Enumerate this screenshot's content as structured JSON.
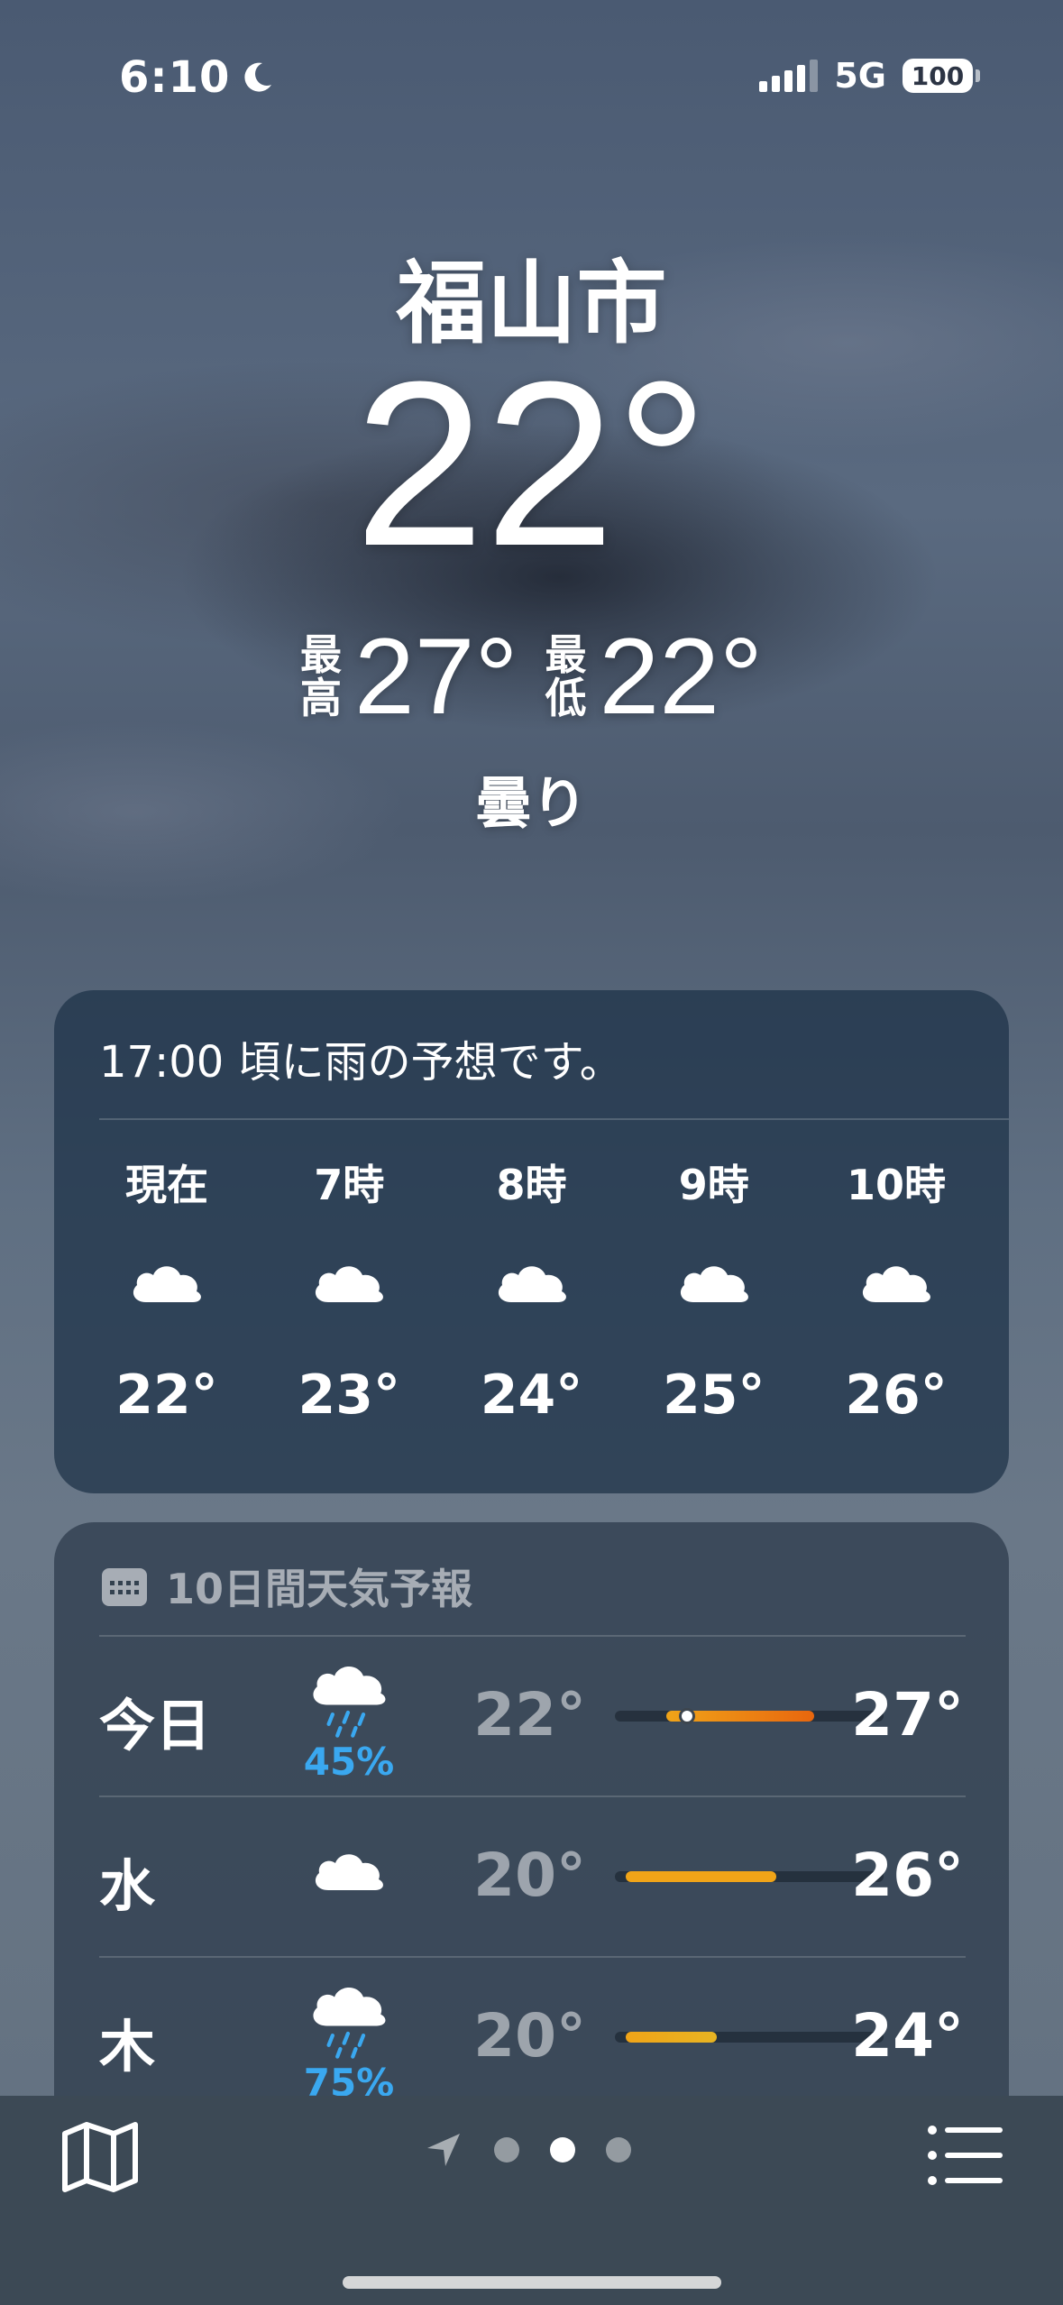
{
  "status_bar": {
    "time": "6:10",
    "network": "5G",
    "battery": "100"
  },
  "header": {
    "city": "福山市",
    "temperature": "22°",
    "high_label": "最高",
    "high": "27°",
    "low_label": "最低",
    "low": "22°",
    "condition": "曇り"
  },
  "hourly": {
    "summary": "17:00 頃に雨の予想です。",
    "items": [
      {
        "label": "現在",
        "icon": "cloud-icon",
        "temp": "22°"
      },
      {
        "label": "7時",
        "icon": "cloud-icon",
        "temp": "23°"
      },
      {
        "label": "8時",
        "icon": "cloud-icon",
        "temp": "24°"
      },
      {
        "label": "9時",
        "icon": "cloud-icon",
        "temp": "25°"
      },
      {
        "label": "10時",
        "icon": "cloud-icon",
        "temp": "26°"
      }
    ]
  },
  "daily": {
    "title": "10日間天気予報",
    "days": [
      {
        "day": "今日",
        "icon": "cloud-rain-icon",
        "pop": "45%",
        "low": "22°",
        "high": "27°",
        "range_start": 0.19,
        "range_end": 0.74,
        "current": 0.27,
        "bar_color": "#e8660e"
      },
      {
        "day": "水",
        "icon": "cloud-icon",
        "pop": "",
        "low": "20°",
        "high": "26°",
        "range_start": 0.04,
        "range_end": 0.6,
        "bar_color": "#f0a418"
      },
      {
        "day": "木",
        "icon": "cloud-rain-icon",
        "pop": "75%",
        "low": "20°",
        "high": "24°",
        "range_start": 0.04,
        "range_end": 0.38,
        "bar_color": "#e8b422"
      }
    ]
  },
  "bottom_bar": {
    "pages": 3,
    "active_page": 2
  }
}
